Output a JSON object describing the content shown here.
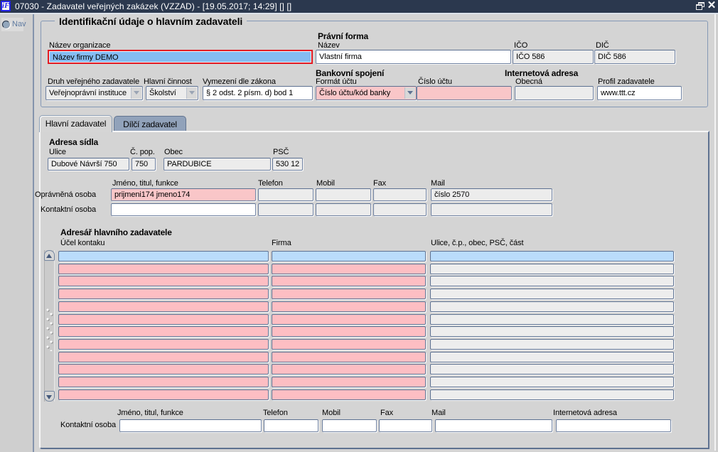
{
  "titlebar": {
    "title": "07030 - Zadavatel veřejných zakázek (VZZAD) - [19.05.2017; 14:29]  []  []",
    "app_icon": "iF"
  },
  "nav": {
    "label": "Nav"
  },
  "identification": {
    "legend": "Identifikační údaje o hlavním zadavateli",
    "nazev_organizace": {
      "label": "Název organizace",
      "value": "Název firmy DEMO"
    },
    "pravni_forma_heading": "Právní forma",
    "nazev": {
      "label": "Název",
      "value": "Vlastní firma"
    },
    "ico": {
      "label": "IČO",
      "value": "IČO 586"
    },
    "dic": {
      "label": "DIČ",
      "value": "DIČ 586"
    },
    "druh_zadavatele": {
      "label": "Druh veřejného zadavatele",
      "value": "Veřejnoprávní instituce"
    },
    "hlavni_cinnost": {
      "label": "Hlavní činnost",
      "value": "Školství"
    },
    "vymezeni": {
      "label": "Vymezení dle zákona",
      "value": "§ 2 odst. 2 písm. d) bod 1"
    },
    "bankovni_heading": "Bankovní spojení",
    "format_uctu": {
      "label": "Formát účtu",
      "value": "Číslo účtu/kód banky"
    },
    "cislo_uctu": {
      "label": "Číslo účtu",
      "value": ""
    },
    "internet_heading": "Internetová adresa",
    "obecna": {
      "label": "Obecná",
      "value": ""
    },
    "profil": {
      "label": "Profil zadavatele",
      "value": "www.ttt.cz"
    }
  },
  "tabs": {
    "active": "Hlavní zadavatel",
    "inactive": "Dílčí zadavatel"
  },
  "address": {
    "heading": "Adresa sídla",
    "ulice": {
      "label": "Ulice",
      "value": "Dubové Návrší 750"
    },
    "cislo_popisne": {
      "label": "Č. pop.",
      "value": "750"
    },
    "obec": {
      "label": "Obec",
      "value": "PARDUBICE"
    },
    "psc": {
      "label": "PSČ",
      "value": "530 12"
    }
  },
  "persons": {
    "col_labels": {
      "name": "Jméno, titul, funkce",
      "phone": "Telefon",
      "mobile": "Mobil",
      "fax": "Fax",
      "mail": "Mail"
    },
    "opravnena": {
      "label": "Oprávněná osoba",
      "name": "prijmeni174 jmeno174",
      "phone": "",
      "mobile": "",
      "fax": "",
      "mail": "číslo 2570"
    },
    "kontaktni": {
      "label": "Kontaktní osoba",
      "name": "",
      "phone": "",
      "mobile": "",
      "fax": "",
      "mail": ""
    }
  },
  "directory": {
    "heading": "Adresář hlavního zadavatele",
    "columns": [
      "Účel kontaku",
      "Firma",
      "Ulice, č.p., obec, PSČ, část"
    ],
    "rows": [
      {
        "selected": true,
        "cells": [
          "",
          "",
          ""
        ]
      },
      {
        "selected": false,
        "cells": [
          "",
          "",
          ""
        ]
      },
      {
        "selected": false,
        "cells": [
          "",
          "",
          ""
        ]
      },
      {
        "selected": false,
        "cells": [
          "",
          "",
          ""
        ]
      },
      {
        "selected": false,
        "cells": [
          "",
          "",
          ""
        ]
      },
      {
        "selected": false,
        "cells": [
          "",
          "",
          ""
        ]
      },
      {
        "selected": false,
        "cells": [
          "",
          "",
          ""
        ]
      },
      {
        "selected": false,
        "cells": [
          "",
          "",
          ""
        ]
      },
      {
        "selected": false,
        "cells": [
          "",
          "",
          ""
        ]
      },
      {
        "selected": false,
        "cells": [
          "",
          "",
          ""
        ]
      },
      {
        "selected": false,
        "cells": [
          "",
          "",
          ""
        ]
      },
      {
        "selected": false,
        "cells": [
          "",
          "",
          ""
        ]
      }
    ]
  },
  "bottom_contact": {
    "label": "Kontaktní osoba",
    "col_labels": {
      "name": "Jméno, titul, funkce",
      "phone": "Telefon",
      "mobile": "Mobil",
      "fax": "Fax",
      "mail": "Mail",
      "web": "Internetová adresa"
    },
    "values": {
      "name": "",
      "phone": "",
      "mobile": "",
      "fax": "",
      "mail": "",
      "web": ""
    }
  },
  "colors": {
    "titlebar": "#2B384E",
    "selection_blue": "#85BCF3",
    "row_selected_blue": "#BADCFB",
    "required_pink": "#F9C6C8",
    "table_pink": "#FDBEC3",
    "focus_border_red": "#E31B23",
    "inactive_tab": "#91A2BA"
  }
}
